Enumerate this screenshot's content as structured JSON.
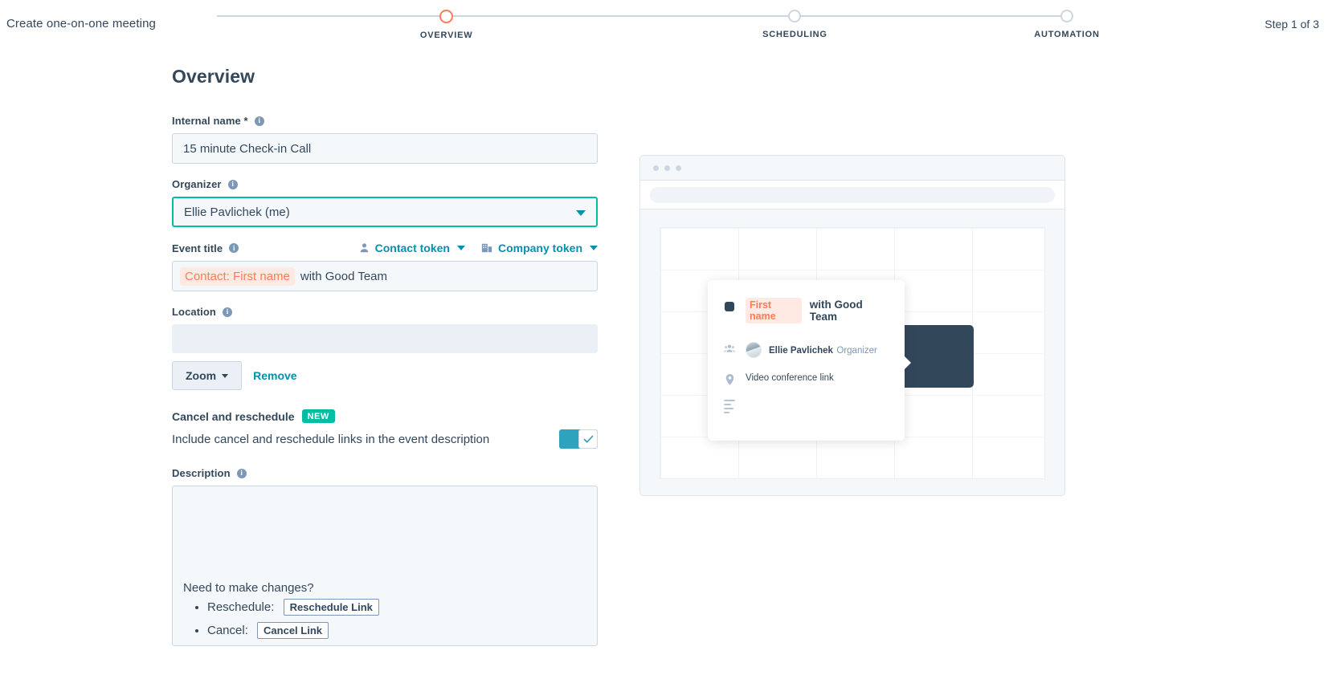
{
  "header": {
    "title": "Create one-on-one meeting",
    "step_count": "Step 1 of 3",
    "steps": [
      {
        "label": "OVERVIEW",
        "state": "active"
      },
      {
        "label": "SCHEDULING",
        "state": "inactive"
      },
      {
        "label": "AUTOMATION",
        "state": "inactive"
      }
    ]
  },
  "page": {
    "title": "Overview"
  },
  "internal_name": {
    "label": "Internal name *",
    "value": "15 minute Check-in Call",
    "info": "info-icon"
  },
  "organizer": {
    "label": "Organizer",
    "value": "Ellie Pavlichek (me)"
  },
  "event_title": {
    "label": "Event title",
    "contact_token_label": "Contact token",
    "company_token_label": "Company token",
    "token_chip": "Contact: First name",
    "rest_text": "with Good Team"
  },
  "location": {
    "label": "Location",
    "value": "",
    "provider_button": "Zoom",
    "remove_label": "Remove"
  },
  "cancel_reschedule": {
    "title": "Cancel and reschedule",
    "badge": "NEW",
    "description": "Include cancel and reschedule links in the event description",
    "toggle_on": true,
    "toggle_accent": "#2ea3bd"
  },
  "description": {
    "label": "Description",
    "heading": "Need to make changes?",
    "items": [
      {
        "prefix": "Reschedule:",
        "link": "Reschedule Link"
      },
      {
        "prefix": "Cancel:",
        "link": "Cancel Link"
      }
    ]
  },
  "preview": {
    "popover": {
      "chip": "First name",
      "title_rest": "with Good Team",
      "organizer_name": "Ellie Pavlichek",
      "organizer_role": "Organizer",
      "location_text": "Video conference link"
    }
  },
  "colors": {
    "accent_orange": "#ff7a59",
    "accent_teal": "#0091ae",
    "accent_green": "#00bda5",
    "text": "#33475b",
    "field_bg": "#f5f8fa",
    "border": "#cbd6e2"
  }
}
